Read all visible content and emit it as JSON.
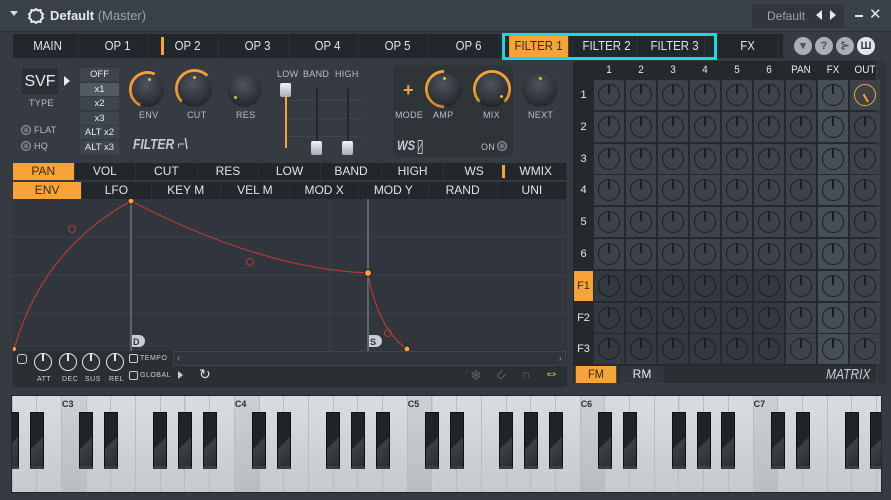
{
  "window": {
    "title": "Default",
    "subtitle": "(Master)",
    "preset": "Default",
    "close_glyph": "✕"
  },
  "tabs": [
    {
      "label": "MAIN",
      "active": false
    },
    {
      "label": "OP 1",
      "active": false
    },
    {
      "label": "OP 2",
      "active": false
    },
    {
      "label": "OP 3",
      "active": false
    },
    {
      "label": "OP 4",
      "active": false
    },
    {
      "label": "OP 5",
      "active": false
    },
    {
      "label": "OP 6",
      "active": false
    },
    {
      "label": "FILTER 1",
      "active": true
    },
    {
      "label": "FILTER 2",
      "active": false
    },
    {
      "label": "FILTER 3",
      "active": false
    },
    {
      "label": "FX",
      "active": false
    }
  ],
  "header_buttons": [
    {
      "name": "menu-dropdown-icon",
      "glyph": "▾"
    },
    {
      "name": "help-icon",
      "glyph": "?"
    },
    {
      "name": "routing-icon",
      "glyph": "⊱"
    },
    {
      "name": "keyboard-icon",
      "glyph": "Ш"
    }
  ],
  "filter": {
    "type_value": "SVF",
    "type_label": "TYPE",
    "multipliers": [
      "OFF",
      "x1",
      "x2",
      "x3",
      "ALT x2",
      "ALT x3"
    ],
    "multiplier_selected": "x1",
    "flat_label": "FLAT",
    "hq_label": "HQ",
    "knobs": [
      {
        "label": "ENV",
        "value": 0.55
      },
      {
        "label": "CUT",
        "value": 0.5
      },
      {
        "label": "RES",
        "value": 0.0
      }
    ],
    "section_label": "FILTER",
    "slider_labels": [
      "LOW",
      "BAND",
      "HIGH"
    ],
    "slider_values": [
      1.0,
      0.0,
      0.0
    ]
  },
  "waveshaper": {
    "mode_label": "MODE",
    "knobs": [
      {
        "label": "AMP",
        "value": 0.5
      },
      {
        "label": "MIX",
        "value": 1.0
      },
      {
        "label": "NEXT",
        "value": 0.5
      }
    ],
    "section_label": "WS",
    "on_label": "ON"
  },
  "targets": [
    {
      "label": "PAN",
      "active": true
    },
    {
      "label": "VOL",
      "active": false
    },
    {
      "label": "CUT",
      "active": false
    },
    {
      "label": "RES",
      "active": false
    },
    {
      "label": "LOW",
      "active": false
    },
    {
      "label": "BAND",
      "active": false
    },
    {
      "label": "HIGH",
      "active": false
    },
    {
      "label": "WS",
      "active": false
    },
    {
      "label": "WMIX",
      "active": false
    }
  ],
  "mod_sources": [
    {
      "label": "ENV",
      "active": true
    },
    {
      "label": "LFO",
      "active": false
    },
    {
      "label": "KEY M",
      "active": false
    },
    {
      "label": "VEL M",
      "active": false
    },
    {
      "label": "MOD X",
      "active": false
    },
    {
      "label": "MOD Y",
      "active": false
    },
    {
      "label": "RAND",
      "active": false
    },
    {
      "label": "UNI",
      "active": false
    }
  ],
  "envelope": {
    "decay_marker": "D",
    "sustain_marker": "S",
    "knobs": [
      "ATT",
      "DEC",
      "SUS",
      "REL"
    ],
    "tempo_label": "TEMPO",
    "global_label": "GLOBAL"
  },
  "matrix": {
    "columns": [
      "1",
      "2",
      "3",
      "4",
      "5",
      "6",
      "PAN",
      "FX",
      "OUT"
    ],
    "rows": [
      "1",
      "2",
      "3",
      "4",
      "5",
      "6",
      "F1",
      "F2",
      "F3"
    ],
    "active_row": "F1",
    "active_out_row": "1",
    "fm_label": "FM",
    "rm_label": "RM",
    "title": "MATRIX"
  },
  "keyboard": {
    "octave_labels": [
      "C3",
      "C4",
      "C5",
      "C6",
      "C7"
    ]
  }
}
